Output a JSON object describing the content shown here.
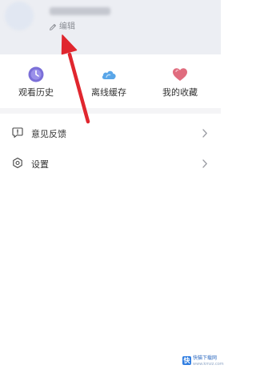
{
  "header": {
    "edit_label": "编辑"
  },
  "quick_actions": [
    {
      "label": "观看历史",
      "icon": "clock-icon",
      "color": "#7b6fd8"
    },
    {
      "label": "离线缓存",
      "icon": "cloud-icon",
      "color": "#5aa6e8"
    },
    {
      "label": "我的收藏",
      "icon": "heart-icon",
      "color": "#e06c7e"
    }
  ],
  "menu": [
    {
      "label": "意见反馈",
      "icon": "feedback-icon"
    },
    {
      "label": "设置",
      "icon": "settings-icon"
    }
  ],
  "watermark": {
    "badge": "快",
    "text": "快猫下载网",
    "sub": "www.kmzz.com"
  },
  "colors": {
    "header_bg": "#eceef3",
    "arrow": "#e0262e",
    "watermark_blue": "#2f7de1"
  }
}
